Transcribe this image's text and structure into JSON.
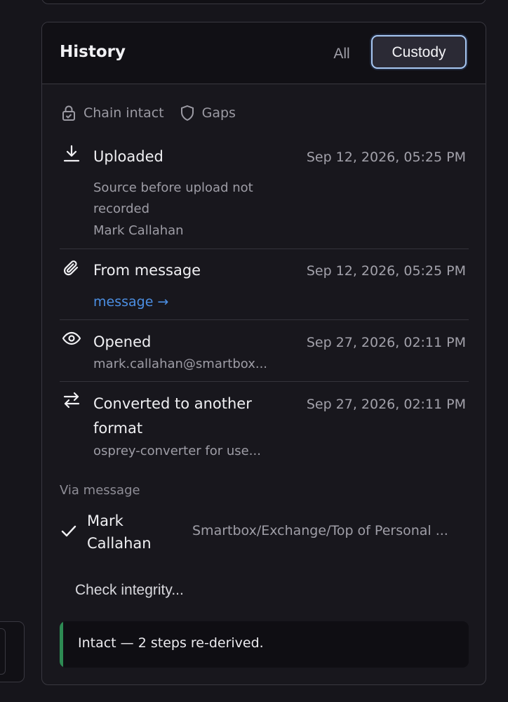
{
  "header": {
    "title": "History",
    "tabs": [
      {
        "label": "All",
        "selected": false
      },
      {
        "label": "Custody",
        "selected": true
      }
    ]
  },
  "filters": [
    {
      "label": "Chain intact",
      "icon": "lock-icon"
    },
    {
      "label": "Gaps",
      "icon": "shield-icon"
    }
  ],
  "events": [
    {
      "icon": "download-icon",
      "title": "Uploaded",
      "time": "Sep 12, 2026, 05:25 PM",
      "detail": "Source before upload not recorded",
      "actor": "Mark Callahan"
    },
    {
      "icon": "paperclip-icon",
      "title": "From message",
      "time": "Sep 12, 2026, 05:25 PM",
      "link": "message →"
    },
    {
      "icon": "eye-icon",
      "title": "Opened",
      "time": "Sep 27, 2026, 02:11 PM",
      "detail": "mark.callahan@smartbox..."
    },
    {
      "icon": "swap-arrows-icon",
      "title": "Converted to another format",
      "time": "Sep 27, 2026, 02:11 PM",
      "detail": "osprey-converter for use..."
    }
  ],
  "via": {
    "label": "Via message",
    "name": "Mark Callahan",
    "path": "Smartbox/Exchange/Top of Personal ..."
  },
  "integrity": {
    "button_label": "Check integrity...",
    "result": "Intact — 2 steps re-derived.",
    "status_color": "#2d8a53"
  },
  "colors": {
    "accent": "#a7c7f2",
    "link": "#4c8fe3"
  }
}
